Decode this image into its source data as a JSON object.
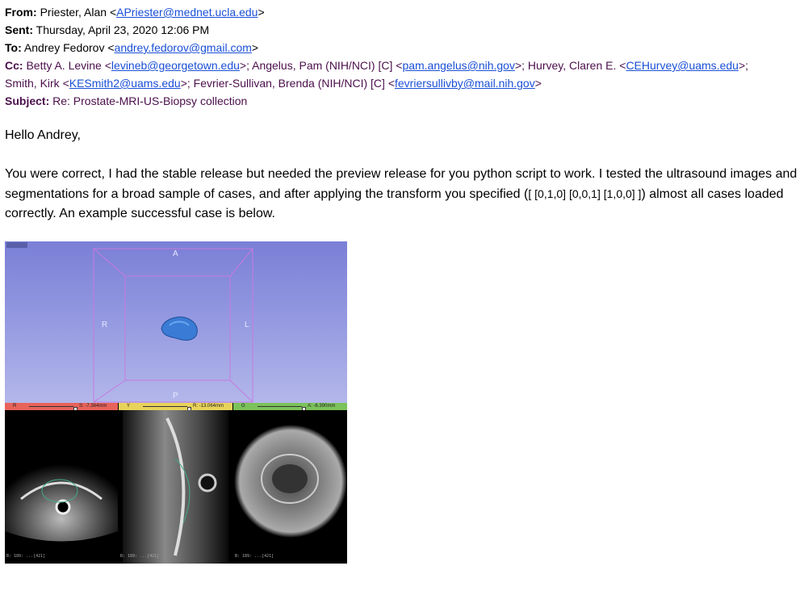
{
  "email": {
    "from_label": "From:",
    "from_name": "Priester, Alan <",
    "from_email": "APriester@mednet.ucla.edu",
    "from_end": ">",
    "sent_label": "Sent:",
    "sent_value": "Thursday, April 23, 2020 12:06 PM",
    "to_label": "To:",
    "to_name": "Andrey Fedorov <",
    "to_email": "andrey.fedorov@gmail.com",
    "to_end": ">",
    "cc_label": "Cc:",
    "cc_1_name": "Betty A. Levine <",
    "cc_1_email": "levineb@georgetown.edu",
    "cc_2_name": ">; Angelus, Pam (NIH/NCI) [C] <",
    "cc_2_email": "pam.angelus@nih.gov",
    "cc_3_name": ">; Hurvey, Claren E. <",
    "cc_3_email": "CEHurvey@uams.edu",
    "cc_3_end": ">;",
    "cc_4_name": "Smith, Kirk <",
    "cc_4_email": "KESmith2@uams.edu",
    "cc_5_name": ">; Fevrier-Sullivan, Brenda (NIH/NCI) [C] <",
    "cc_5_email": "fevriersullivby@mail.nih.gov",
    "cc_5_end": ">",
    "subject_label": "Subject:",
    "subject_value": "Re: Prostate-MRI-US-Biopsy collection",
    "greeting": "Hello Andrey,",
    "body_before": "You were correct, I had the stable release but needed the preview release for you python script to work. I tested the ultrasound images and segmentations for a broad sample of cases, and after applying the transform you specified (",
    "body_transform": "[ [0,1,0] [0,0,1] [1,0,0] ]",
    "body_after": ") almost all cases loaded correctly. An example successful case is below."
  },
  "viewer": {
    "orient_a": "A",
    "orient_p": "P",
    "orient_r": "R",
    "orient_l": "L",
    "red_tag": "R",
    "red_value": "S: -7.384mm",
    "yellow_tag": "Y",
    "yellow_value": "R: -13.064mm",
    "green_tag": "G",
    "green_value": "A: -6.390mm",
    "slice_info_red": "B: 189: ...[421]",
    "slice_info_yellow": "B: 189: ...[421]",
    "slice_info_green": "B: 189: ...[421]",
    "colors": {
      "red_bar": "#e8635a",
      "yellow_bar": "#e8d35a",
      "green_bar": "#7cc25a",
      "segment": "#3a7bd5"
    }
  }
}
